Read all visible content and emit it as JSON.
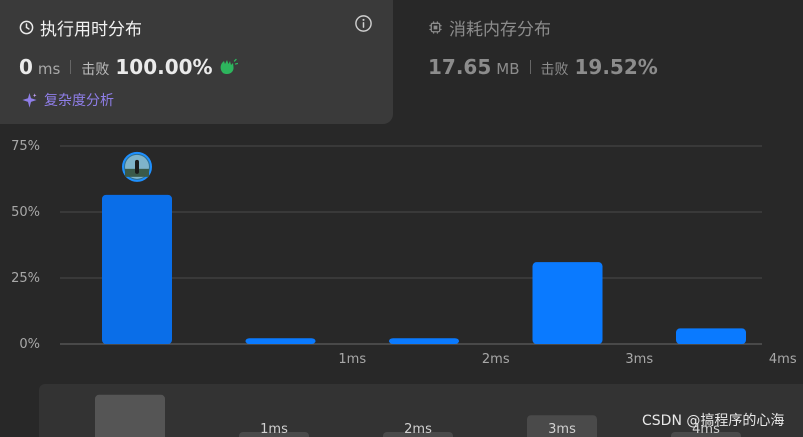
{
  "runtime": {
    "title": "执行用时分布",
    "value": "0",
    "unit": "ms",
    "beat_label": "击败",
    "beat_value": "100.00%",
    "complexity_label": "复杂度分析"
  },
  "memory": {
    "title": "消耗内存分布",
    "value": "17.65",
    "unit": "MB",
    "beat_label": "击败",
    "beat_value": "19.52%"
  },
  "colors": {
    "bar": "#0a7aff",
    "active_bar": "#0a6ee8",
    "mini_bar": "#4a4a4a",
    "accent_purple": "#8f7ee8",
    "clap_green": "#2db55d"
  },
  "icons": [
    "clock-icon",
    "info-icon",
    "chip-icon",
    "clap-icon",
    "sparkle-icon",
    "avatar"
  ],
  "chart_data": {
    "type": "bar",
    "categories": [
      "",
      "1ms",
      "2ms",
      "3ms",
      "4ms"
    ],
    "values": [
      56.5,
      2.2,
      2.2,
      31.0,
      5.9
    ],
    "y_ticks": [
      "0%",
      "25%",
      "50%",
      "75%"
    ],
    "y_tick_values": [
      0,
      25,
      50,
      75
    ],
    "ylim": [
      0,
      75
    ],
    "grid": true,
    "active_index": 0
  },
  "mini_chart": {
    "labels": [
      "",
      "1ms",
      "2ms",
      "3ms",
      "4ms"
    ],
    "values": [
      56.5,
      2.2,
      2.2,
      31.0,
      5.9
    ]
  },
  "watermark": "CSDN @搞程序的心海"
}
